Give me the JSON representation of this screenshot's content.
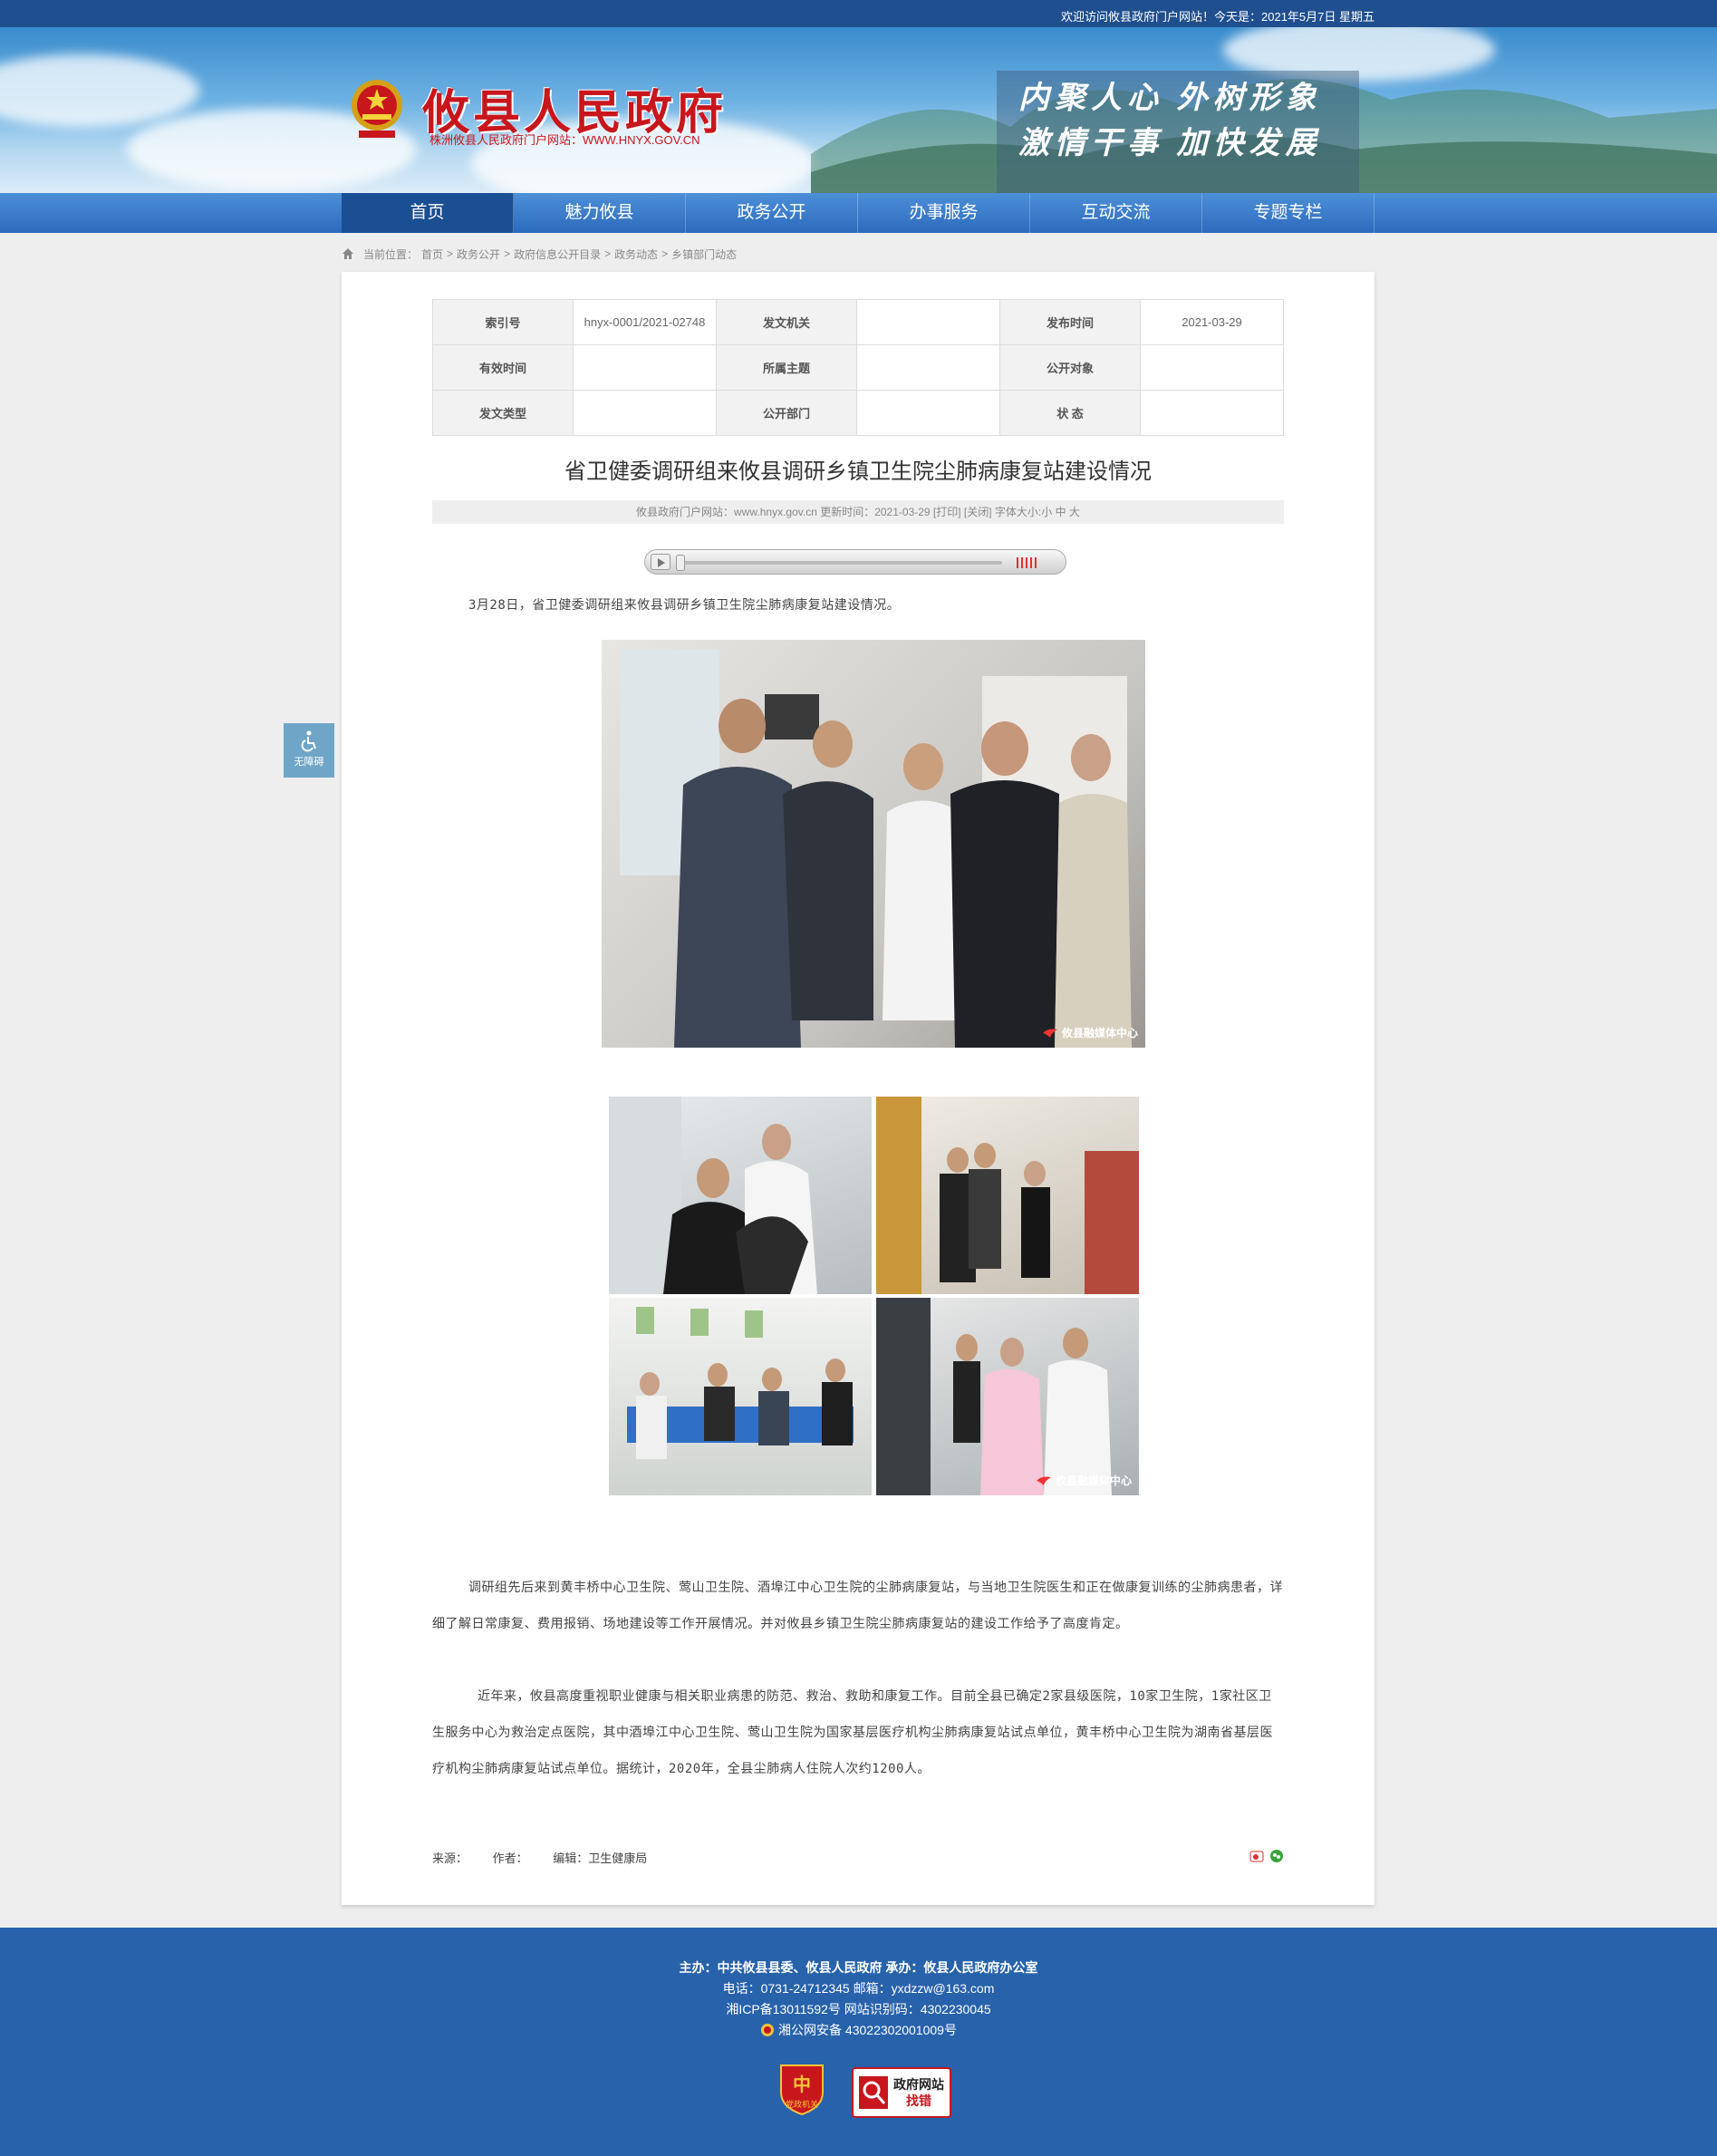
{
  "topbar": {
    "welcome": "欢迎访问攸县政府门户网站！今天是：2021年5月7日 星期五"
  },
  "header": {
    "site_name": "攸县人民政府",
    "site_sub": "株洲攸县人民政府门户网站：WWW.HNYX.GOV.CN",
    "slogan_line1": "内聚人心  外树形象",
    "slogan_line2": "激情干事  加快发展"
  },
  "nav": {
    "items": [
      {
        "label": "首页"
      },
      {
        "label": "魅力攸县"
      },
      {
        "label": "政务公开"
      },
      {
        "label": "办事服务"
      },
      {
        "label": "互动交流"
      },
      {
        "label": "专题专栏"
      }
    ]
  },
  "breadcrumb": {
    "prefix": "当前位置：",
    "items": [
      "首页",
      "政务公开",
      "政府信息公开目录",
      "政务动态",
      "乡镇部门动态"
    ],
    "sep": ">"
  },
  "meta": {
    "index_label": "索引号",
    "index_value": "hnyx-0001/2021-02748",
    "issuer_label": "发文机关",
    "issuer_value": "",
    "pubtime_label": "发布时间",
    "pubtime_value": "2021-03-29",
    "valid_label": "有效时间",
    "valid_value": "",
    "topic_label": "所属主题",
    "topic_value": "",
    "audience_label": "公开对象",
    "audience_value": "",
    "doctype_label": "发文类型",
    "doctype_value": "",
    "dept_label": "公开部门",
    "dept_value": "",
    "status_label": "状 态",
    "status_value": ""
  },
  "article": {
    "title": "省卫健委调研组来攸县调研乡镇卫生院尘肺病康复站建设情况",
    "info": "攸县政府门户网站：www.hnyx.gov.cn  更新时间：2021-03-29  [打印]  [关闭]  字体大小:小 中 大",
    "para1": "3月28日，省卫健委调研组来攸县调研乡镇卫生院尘肺病康复站建设情况。",
    "para2": "调研组先后来到黄丰桥中心卫生院、莺山卫生院、酒埠江中心卫生院的尘肺病康复站，与当地卫生院医生和正在做康复训练的尘肺病患者，详细了解日常康复、费用报销、场地建设等工作开展情况。并对攸县乡镇卫生院尘肺病康复站的建设工作给予了高度肯定。",
    "para3": "近年来，攸县高度重视职业健康与相关职业病患的防范、救治、救助和康复工作。目前全县已确定2家县级医院，10家卫生院，1家社区卫生服务中心为救治定点医院，其中酒埠江中心卫生院、莺山卫生院为国家基层医疗机构尘肺病康复站试点单位，黄丰桥中心卫生院为湖南省基层医疗机构尘肺病康复站试点单位。据统计，2020年，全县尘肺病人住院人次约1200人。",
    "watermark": "攸县融媒体中心",
    "source_label": "来源：",
    "author_label": "作者：",
    "editor_label": "编辑：",
    "editor_value": "卫生健康局"
  },
  "accessibility": {
    "label": "无障碍"
  },
  "footer": {
    "line1": "主办：中共攸县县委、攸县人民政府 承办：攸县人民政府办公室",
    "line2": "电话：0731-24712345 邮箱：yxdzzw@163.com",
    "line3": "湘ICP备13011592号   网站识别码：4302230045",
    "line4": "湘公网安备 43022302001009号",
    "badge1_text": "党政机关",
    "badge2_line1": "政府网站",
    "badge2_line2": "找错"
  }
}
